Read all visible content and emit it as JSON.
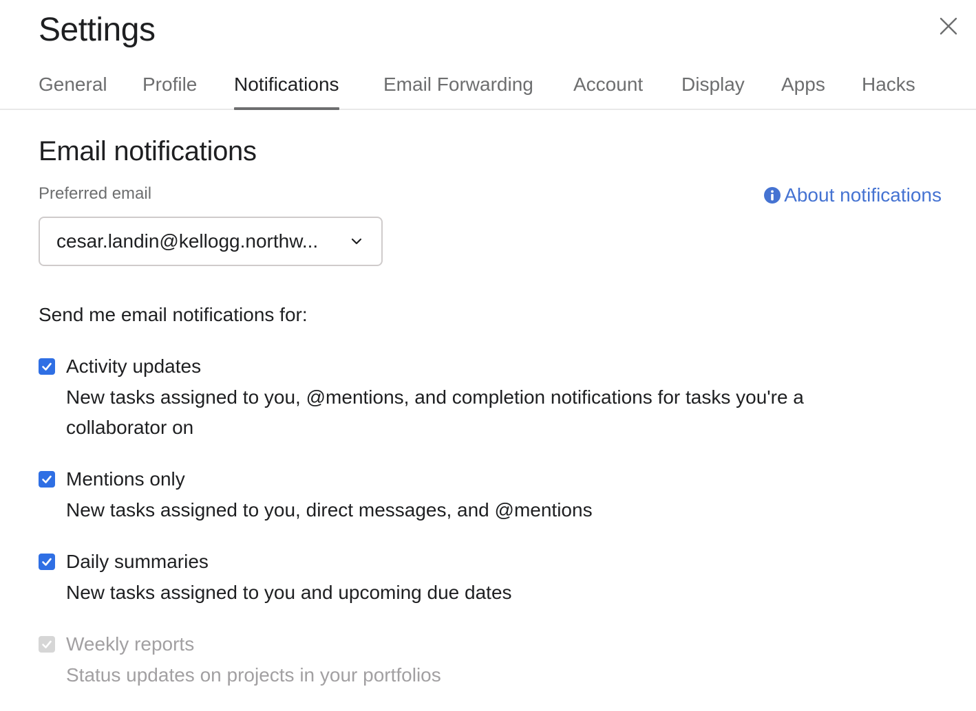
{
  "dialog": {
    "title": "Settings"
  },
  "tabs": [
    {
      "label": "General"
    },
    {
      "label": "Profile"
    },
    {
      "label": "Notifications"
    },
    {
      "label": "Email Forwarding"
    },
    {
      "label": "Account"
    },
    {
      "label": "Display"
    },
    {
      "label": "Apps"
    },
    {
      "label": "Hacks"
    }
  ],
  "active_tab": "Notifications",
  "section": {
    "title": "Email notifications",
    "about_link": "About notifications"
  },
  "preferred_email": {
    "label": "Preferred email",
    "value": "cesar.landin@kellogg.northw..."
  },
  "prompt": "Send me email notifications for:",
  "options": [
    {
      "title": "Activity updates",
      "description": "New tasks assigned to you, @mentions, and completion notifications for tasks you're a collaborator on",
      "checked": true,
      "disabled": false
    },
    {
      "title": "Mentions only",
      "description": "New tasks assigned to you, direct messages, and @mentions",
      "checked": true,
      "disabled": false
    },
    {
      "title": "Daily summaries",
      "description": "New tasks assigned to you and upcoming due dates",
      "checked": true,
      "disabled": false
    },
    {
      "title": "Weekly reports",
      "description": "Status updates on projects in your portfolios",
      "checked": true,
      "disabled": true
    }
  ],
  "colors": {
    "accent": "#2f6fe4",
    "link": "#4573d2",
    "muted_text": "#6d6e6f",
    "disabled_text": "#a2a0a2"
  },
  "icons": {
    "close": "close-icon",
    "info": "info-icon",
    "dropdown": "chevron-down-icon",
    "check": "checkmark-icon"
  }
}
